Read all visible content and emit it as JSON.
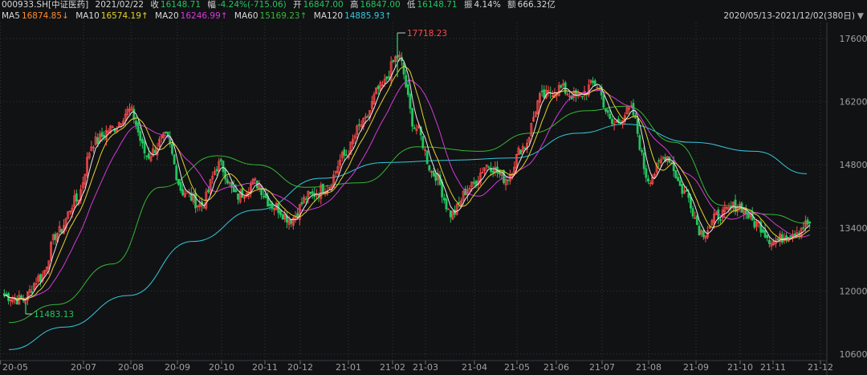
{
  "header": {
    "symbol": "000933.SH[中证医药]",
    "date": "2021/02/22",
    "close_label": "收",
    "close": "16148.71",
    "change_label": "幅",
    "change": "-4.24%(-715.06)",
    "open_label": "开",
    "open": "16847.00",
    "high_label": "高",
    "high": "16847.00",
    "low_label": "低",
    "low": "16148.71",
    "amplitude_label": "振",
    "amplitude": "4.14%",
    "amount_label": "额",
    "amount": "666.32亿"
  },
  "ma_bar": {
    "ma5_label": "MA5",
    "ma5_value": "16874.85↓",
    "ma10_label": "MA10",
    "ma10_value": "16574.19↑",
    "ma20_label": "MA20",
    "ma20_value": "16246.99↑",
    "ma60_label": "MA60",
    "ma60_value": "15169.23↑",
    "ma120_label": "MA120",
    "ma120_value": "14885.93↑"
  },
  "date_range": "2020/05/13-2021/12/02(380日)",
  "colors": {
    "up": "#ff4b4b",
    "down": "#23c55e",
    "doji": "#dcdcdc",
    "ma5": "#e8e8e8",
    "ma10": "#e6d22e",
    "ma20": "#d63ad8",
    "ma60": "#35b935",
    "ma120": "#33c8dc",
    "grid": "#343539",
    "axis_text": "#a0a0a0",
    "max_label": "#ff4b4b",
    "min_label": "#23c55e"
  },
  "chart_data": {
    "type": "candlestick",
    "x_axis_labels": [
      "20-05",
      "20-07",
      "20-08",
      "20-09",
      "20-10",
      "20-11",
      "20-12",
      "21-01",
      "21-02",
      "21-03",
      "21-04",
      "21-05",
      "21-06",
      "21-07",
      "21-08",
      "21-09",
      "21-10",
      "21-11",
      "21-12"
    ],
    "y_axis_labels": [
      "17600",
      "16200",
      "14800",
      "13400",
      "12000",
      "10600"
    ],
    "ylim": [
      10600,
      17600
    ],
    "grid": true,
    "annotations": [
      {
        "text": "17718.23",
        "kind": "max",
        "x": "2021-02"
      },
      {
        "text": "11483.13",
        "kind": "min",
        "x": "2020-05"
      }
    ],
    "waypoints": [
      [
        "20-05",
        11900
      ],
      [
        "20-06a",
        11800
      ],
      [
        "20-06b",
        12300
      ],
      [
        "20-06c",
        13300
      ],
      [
        "20-07a",
        14000
      ],
      [
        "20-07b",
        15300
      ],
      [
        "20-08a",
        15600
      ],
      [
        "20-08b",
        16000
      ],
      [
        "20-08c",
        15000
      ],
      [
        "20-09a",
        15400
      ],
      [
        "20-09b",
        14200
      ],
      [
        "20-09c",
        13900
      ],
      [
        "20-10a",
        14800
      ],
      [
        "20-10b",
        14100
      ],
      [
        "20-11a",
        14400
      ],
      [
        "20-11b",
        13900
      ],
      [
        "20-11c",
        13600
      ],
      [
        "20-12a",
        14100
      ],
      [
        "20-12b",
        14300
      ],
      [
        "21-01a",
        15000
      ],
      [
        "21-01b",
        15700
      ],
      [
        "21-02a",
        16500
      ],
      [
        "21-02b",
        17200
      ],
      [
        "21-02c",
        15600
      ],
      [
        "21-03a",
        14600
      ],
      [
        "21-03b",
        13700
      ],
      [
        "21-03c",
        14300
      ],
      [
        "21-04a",
        14800
      ],
      [
        "21-04b",
        14500
      ],
      [
        "21-05a",
        15200
      ],
      [
        "21-05b",
        16300
      ],
      [
        "21-06a",
        16500
      ],
      [
        "21-06b",
        16300
      ],
      [
        "21-07a",
        16600
      ],
      [
        "21-07b",
        15700
      ],
      [
        "21-07c",
        16000
      ],
      [
        "21-08a",
        14500
      ],
      [
        "21-08b",
        15000
      ],
      [
        "21-08c",
        14200
      ],
      [
        "21-09a",
        13300
      ],
      [
        "21-09b",
        13700
      ],
      [
        "21-10a",
        13900
      ],
      [
        "21-10b",
        13500
      ],
      [
        "21-11a",
        13100
      ],
      [
        "21-11b",
        13300
      ],
      [
        "21-12",
        13500
      ]
    ],
    "ma120_line": [
      [
        11,
        10700
      ],
      [
        80,
        11200
      ],
      [
        160,
        11900
      ],
      [
        240,
        13100
      ],
      [
        320,
        13800
      ],
      [
        400,
        14500
      ],
      [
        480,
        14850
      ],
      [
        560,
        14900
      ],
      [
        640,
        14950
      ],
      [
        720,
        15500
      ],
      [
        780,
        15700
      ],
      [
        860,
        15300
      ],
      [
        940,
        15100
      ],
      [
        1005,
        14600
      ]
    ],
    "ma60_line": [
      [
        11,
        11300
      ],
      [
        70,
        11700
      ],
      [
        140,
        12600
      ],
      [
        200,
        14300
      ],
      [
        270,
        15000
      ],
      [
        320,
        14800
      ],
      [
        380,
        14300
      ],
      [
        450,
        14400
      ],
      [
        520,
        15200
      ],
      [
        600,
        15100
      ],
      [
        660,
        15500
      ],
      [
        730,
        16000
      ],
      [
        780,
        16100
      ],
      [
        840,
        15300
      ],
      [
        900,
        13900
      ],
      [
        960,
        13700
      ],
      [
        1005,
        13500
      ]
    ]
  }
}
